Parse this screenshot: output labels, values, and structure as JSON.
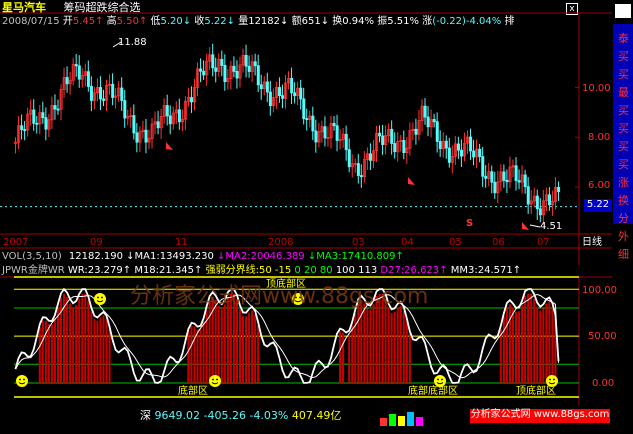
{
  "header": {
    "stock_name": "星马汽车",
    "indicator_name": "筹码超跌综合选",
    "quote": {
      "date": "2008/07/15",
      "open_label": "开",
      "open": "5.45",
      "high_label": "高",
      "high": "5.50",
      "low_label": "低",
      "low": "5.20",
      "close_label": "收",
      "close": "5.22",
      "vol_label": "量",
      "vol": "12182",
      "amount_label": "额",
      "amount": "651",
      "turnover_label": "换",
      "turnover": "0.94%",
      "amplitude_label": "振",
      "amplitude": "5.51%",
      "change_label": "涨",
      "change": "(-0.22)-4.04%",
      "tail": "排"
    }
  },
  "price_chart": {
    "high_marker": "11.88",
    "low_marker": "4.51",
    "current_price_tag": "5.22",
    "s_marker": "S",
    "y_ticks": [
      "10.00",
      "8.00",
      "6.00"
    ],
    "x_ticks": [
      "2007",
      "09",
      "11",
      "2008",
      "03",
      "04",
      "05",
      "06",
      "07"
    ],
    "period_label": "日线"
  },
  "volume_line": {
    "vol_label": "VOL(3,5,10)",
    "vol_value": "12182.190",
    "ma1": "↓MA1:13493.230",
    "ma2": "↓MA2:20046.389",
    "ma3": "↓MA3:17410.809↑"
  },
  "indicator_line": {
    "name": "JPWR金牌WR",
    "wr": "WR:23.279↑",
    "m18": "M18:21.345↑",
    "dividing": "强弱分界线:50",
    "values": [
      "-15",
      "0",
      "20",
      "80",
      "100",
      "113"
    ],
    "d27": "D27:26.623↑",
    "mm3": "MM3:24.571↑"
  },
  "indicator_chart": {
    "top_zone_label": "顶底部区",
    "bottom_zone_label": "底部区",
    "bottom_zone_label2": "底部底部区",
    "bottom_zone_label3": "顶底部区",
    "watermark": "分析家公式网www.88gs.com",
    "y_ticks": [
      "100.00",
      "50.00",
      "0.00"
    ]
  },
  "right_panel": {
    "items": [
      "泰",
      "买",
      "买",
      "最",
      "买",
      "买",
      "买",
      "买",
      "涨",
      "换",
      "分",
      "外",
      "细"
    ]
  },
  "status_bar": {
    "market": "深",
    "index_value": "9649.02",
    "index_change": "-405.26",
    "index_pct": "-4.03%",
    "amount": "407.49亿",
    "site": "分析家公式网 www.88gs.com"
  },
  "colors": {
    "up": "#ff3232",
    "down": "#54fcfc",
    "bar_red": "#c80000",
    "line_white": "#ffffff",
    "line_yellow": "#ffff00",
    "grid_green": "#00c000",
    "axis_red": "#a00000"
  },
  "chart_data": [
    {
      "type": "line",
      "title": "星马汽车 日线",
      "x": [
        "2007",
        "09",
        "11",
        "2008",
        "03",
        "04",
        "05",
        "06",
        "07"
      ],
      "series": [
        {
          "name": "收盘价",
          "values": [
            7.8,
            10.6,
            8.0,
            11.1,
            9.7,
            7.0,
            8.5,
            6.6,
            5.22
          ]
        }
      ],
      "ylim": [
        4.2,
        12.3
      ],
      "y_ticks": [
        6,
        8,
        10
      ]
    },
    {
      "type": "line",
      "title": "JPWR金牌WR",
      "series": [
        {
          "name": "WR",
          "values": [
            23.279
          ]
        },
        {
          "name": "M18",
          "values": [
            21.345
          ]
        },
        {
          "name": "D27",
          "values": [
            26.623
          ]
        },
        {
          "name": "MM3",
          "values": [
            24.571
          ]
        }
      ],
      "reference_lines": [
        -15,
        0,
        20,
        50,
        80,
        100,
        113
      ],
      "ylim": [
        -15,
        113
      ]
    }
  ]
}
